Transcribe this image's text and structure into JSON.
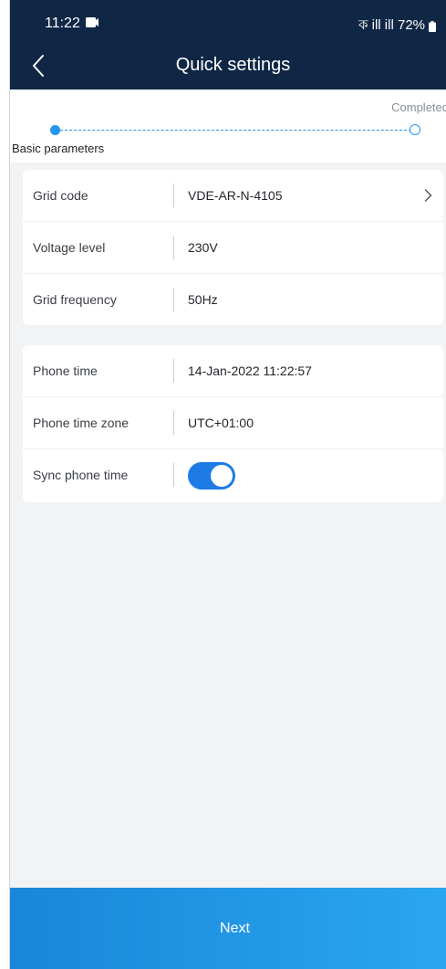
{
  "status_bar": {
    "time": "11:22",
    "signal_text": "ক ill ill 72%"
  },
  "header": {
    "title": "Quick settings",
    "back_icon": "back-arrow-icon"
  },
  "stepper": {
    "current_step": "Basic parameters",
    "final_step": "Completed",
    "accent_color": "#2196f3"
  },
  "grid_settings": [
    {
      "label": "Grid code",
      "value": "VDE-AR-N-4105",
      "has_chevron": true
    },
    {
      "label": "Voltage level",
      "value": "230V"
    },
    {
      "label": "Grid frequency",
      "value": "50Hz"
    }
  ],
  "time_settings": {
    "phone_time": {
      "label": "Phone time",
      "value": "14-Jan-2022 11:22:57"
    },
    "phone_time_zone": {
      "label": "Phone time zone",
      "value": "UTC+01:00"
    },
    "sync_phone_time": {
      "label": "Sync phone time",
      "toggle_on": true
    }
  },
  "footer": {
    "next_label": "Next"
  },
  "colors": {
    "header_bg": "#0f2745",
    "toggle_on": "#1e7be6",
    "button_gradient_start": "#1a86d9",
    "button_gradient_end": "#2aa6f0"
  }
}
